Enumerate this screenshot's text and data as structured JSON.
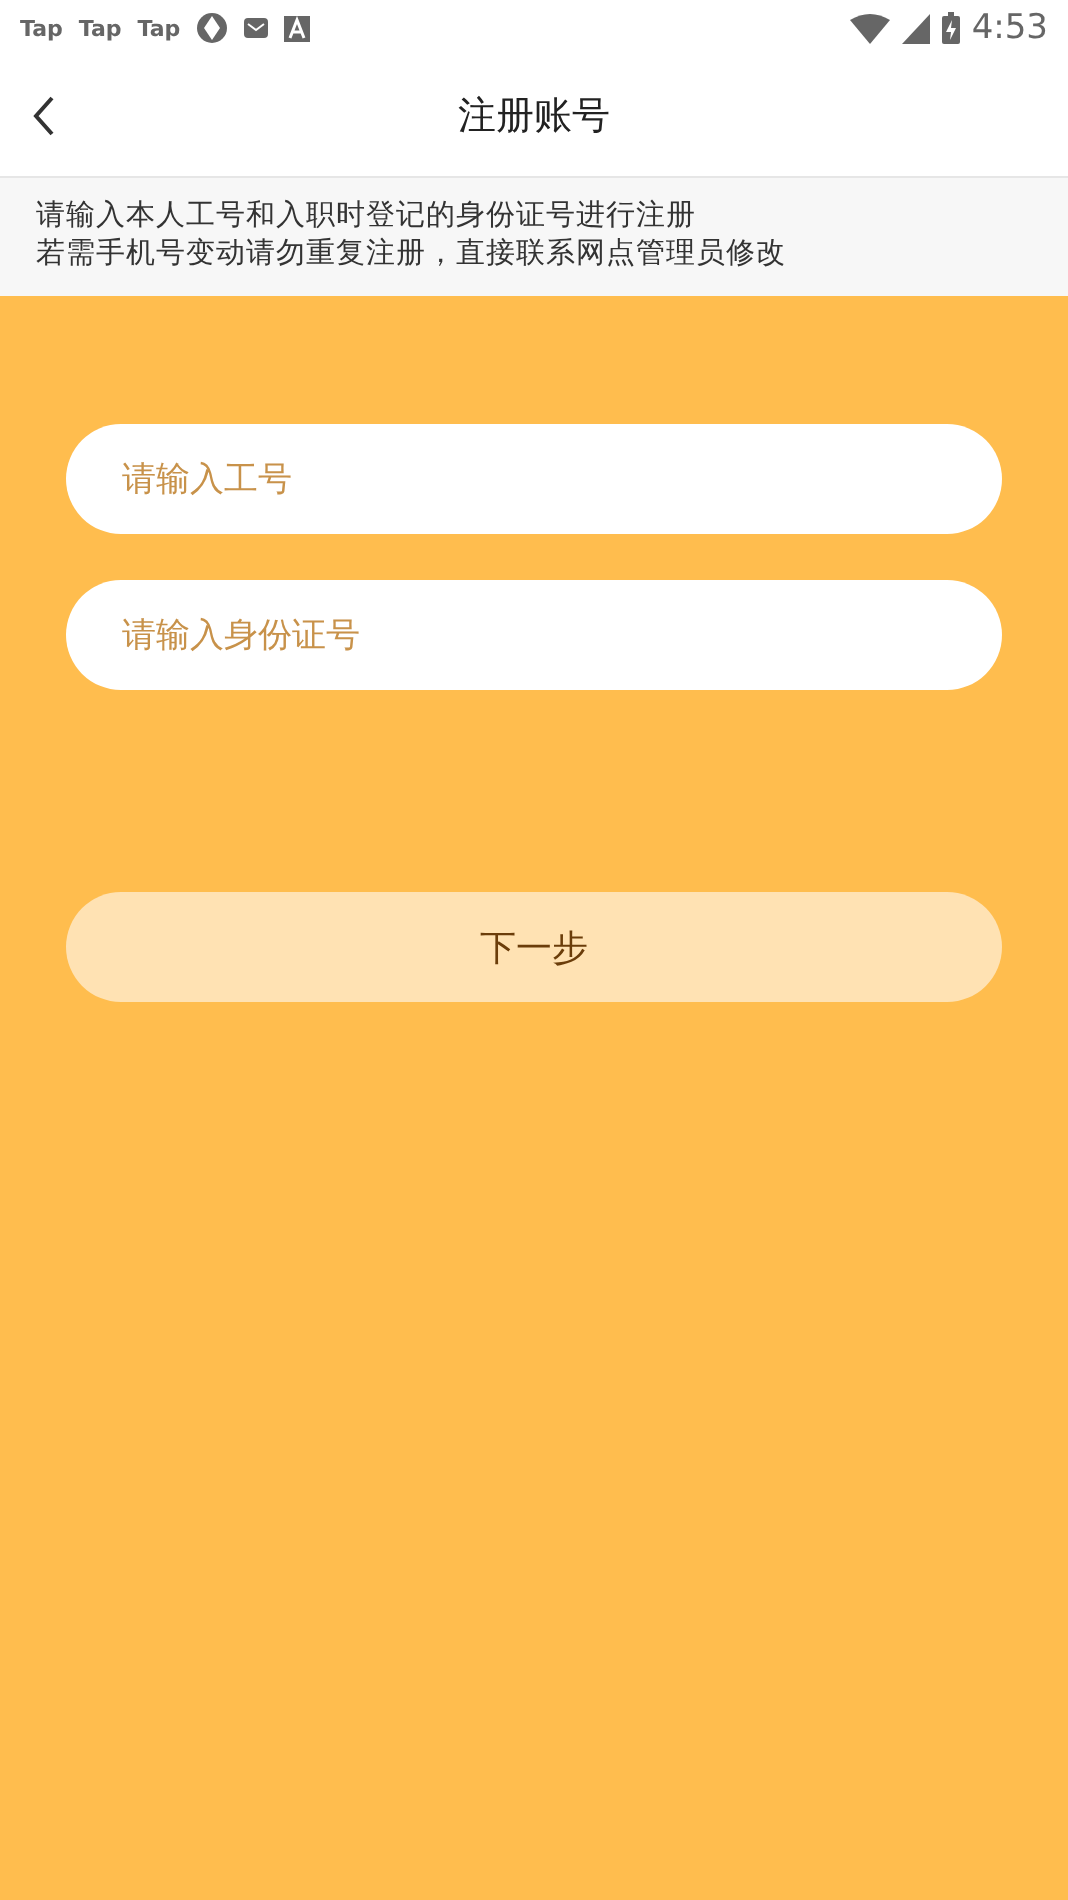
{
  "status_bar": {
    "app_labels": [
      "Tap",
      "Tap",
      "Tap"
    ],
    "time": "4:53"
  },
  "header": {
    "title": "注册账号"
  },
  "notice": {
    "lines": [
      "请输入本人工号和入职时登记的身份证号进行注册",
      "若需手机号变动请勿重复注册，直接联系网点管理员修改"
    ]
  },
  "form": {
    "fields": [
      {
        "placeholder": "请输入工号"
      },
      {
        "placeholder": "请输入身份证号"
      }
    ],
    "next_button": {
      "label": "下一步",
      "disabled": true
    }
  }
}
